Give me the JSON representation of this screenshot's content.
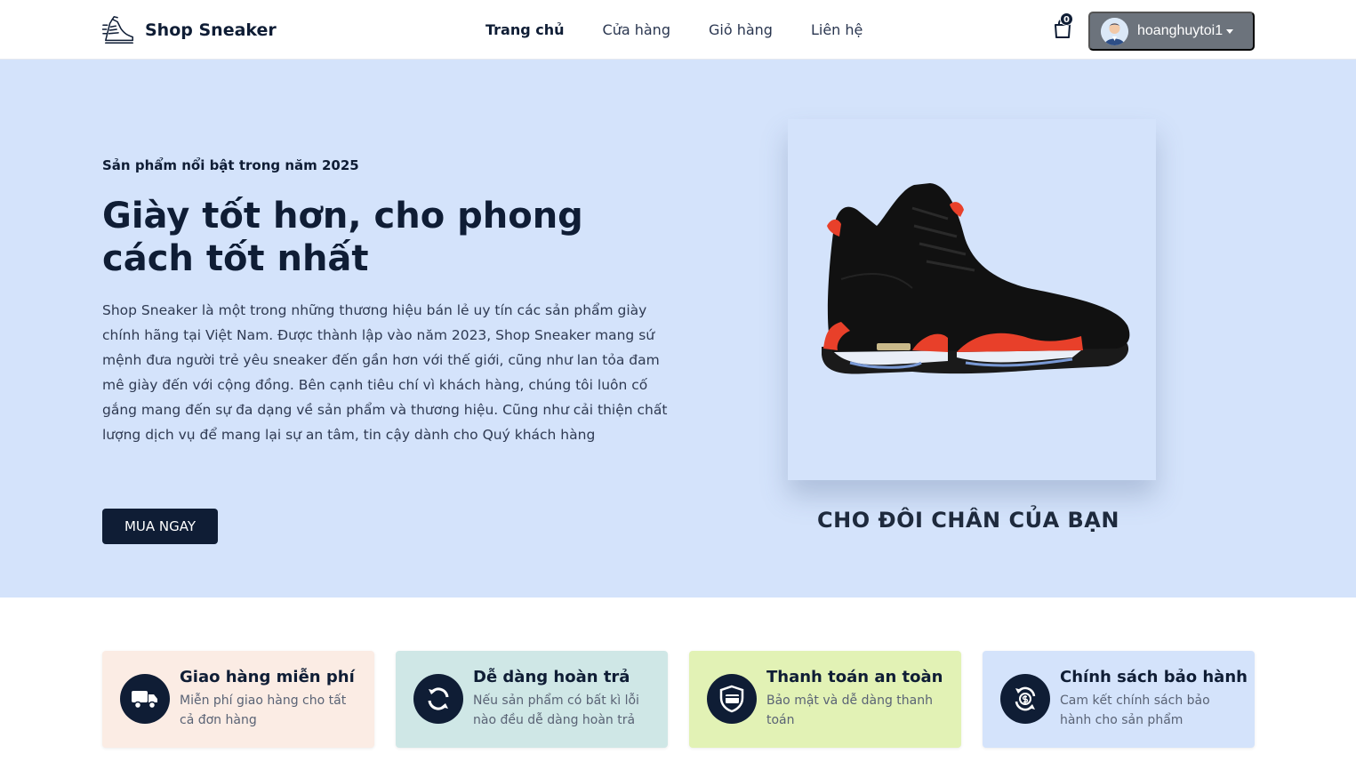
{
  "brand": {
    "name": "Shop Sneaker",
    "logo_icon": "sneaker-logo-icon"
  },
  "nav": {
    "items": [
      {
        "label": "Trang chủ",
        "active": true
      },
      {
        "label": "Cửa hàng",
        "active": false
      },
      {
        "label": "Giỏ hàng",
        "active": false
      },
      {
        "label": "Liên hệ",
        "active": false
      }
    ],
    "cart_count": "0",
    "user": {
      "name": "hoanghuytoi1"
    }
  },
  "hero": {
    "eyebrow": "Sản phẩm nổi bật trong năm 2025",
    "title": "Giày tốt hơn, cho phong cách tốt nhất",
    "description": "Shop Sneaker là một trong những thương hiệu bán lẻ uy tín các sản phẩm giày chính hãng tại Việt Nam. Được thành lập vào năm 2023, Shop Sneaker mang sứ mệnh đưa người trẻ yêu sneaker đến gần hơn với thế giới, cũng như lan tỏa đam mê giày đến với cộng đồng. Bên cạnh tiêu chí vì khách hàng, chúng tôi luôn cố gắng mang đến sự đa dạng về sản phẩm và thương hiệu. Cũng như cải thiện chất lượng dịch vụ để mang lại sự an tâm, tin cậy dành cho Quý khách hàng",
    "cta": "MUA NGAY",
    "card_caption": "CHO ĐÔI CHÂN CỦA BẠN"
  },
  "features": [
    {
      "title": "Giao hàng miễn phí",
      "desc": "Miễn phí giao hàng cho tất cả đơn hàng",
      "icon": "truck-icon",
      "bg": "#fbece4"
    },
    {
      "title": "Dễ dàng hoàn trả",
      "desc": "Nếu sản phẩm có bất kì lỗi nào đều dễ dàng hoàn trả",
      "icon": "return-icon",
      "bg": "#cfe7e6"
    },
    {
      "title": "Thanh toán an toàn",
      "desc": "Bảo mật và dễ dàng thanh toán",
      "icon": "secure-payment-icon",
      "bg": "#e2f2b5"
    },
    {
      "title": "Chính sách bảo hành",
      "desc": "Cam kết chính sách bảo hành cho sản phẩm",
      "icon": "warranty-icon",
      "bg": "#d4e3fb"
    }
  ],
  "colors": {
    "primary": "#0f1d35",
    "hero_bg": "#d4e3fb",
    "user_button": "#6c737c"
  }
}
